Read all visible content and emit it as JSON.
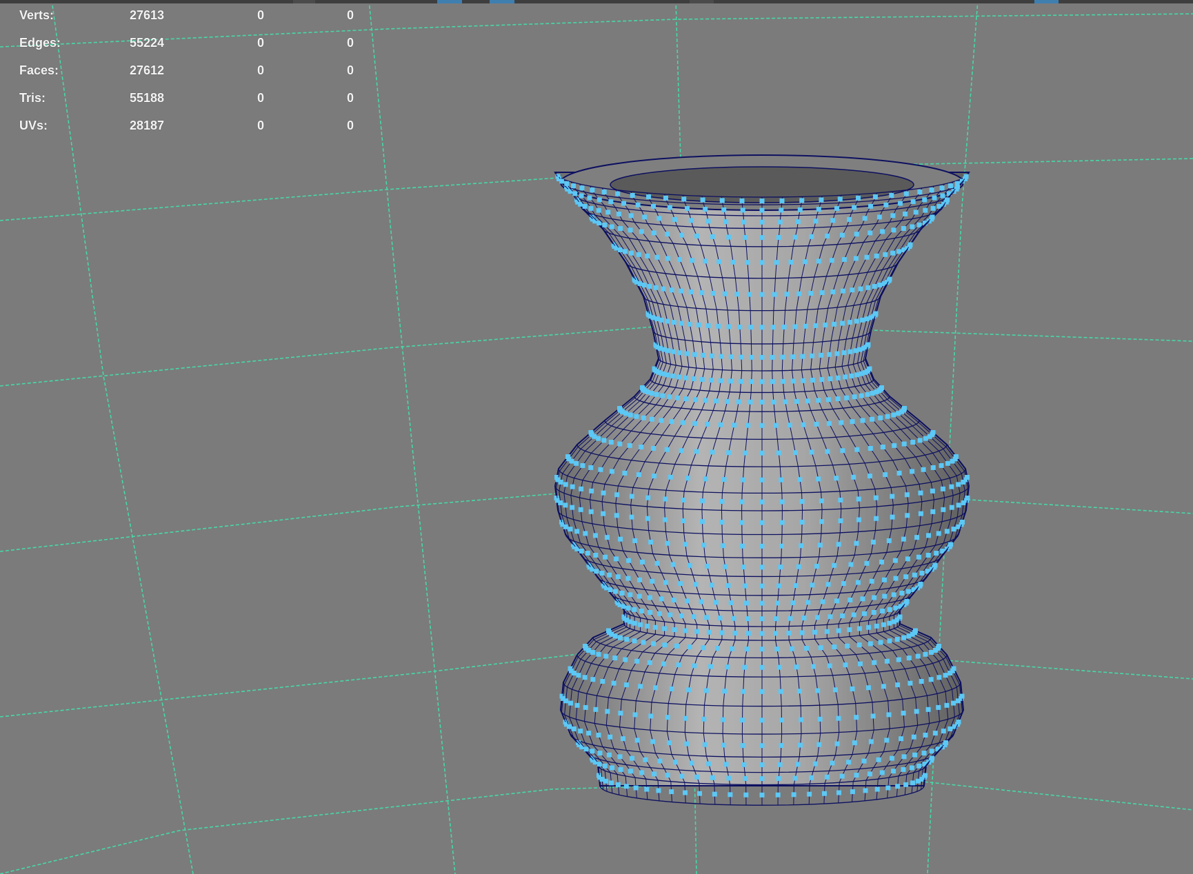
{
  "viewport": {
    "background": "#7b7b7b",
    "grid_color": "#46d9a8",
    "wire_color": "#0d1060",
    "vertex_color": "#5cc8f5",
    "surface_color": "#9a9a9a"
  },
  "hud": {
    "rows": [
      {
        "label": "Verts:",
        "total": "27613",
        "selected": "0",
        "highlighted": "0"
      },
      {
        "label": "Edges:",
        "total": "55224",
        "selected": "0",
        "highlighted": "0"
      },
      {
        "label": "Faces:",
        "total": "27612",
        "selected": "0",
        "highlighted": "0"
      },
      {
        "label": "Tris:",
        "total": "55188",
        "selected": "0",
        "highlighted": "0"
      },
      {
        "label": "UVs:",
        "total": "28187",
        "selected": "0",
        "highlighted": "0"
      }
    ]
  }
}
